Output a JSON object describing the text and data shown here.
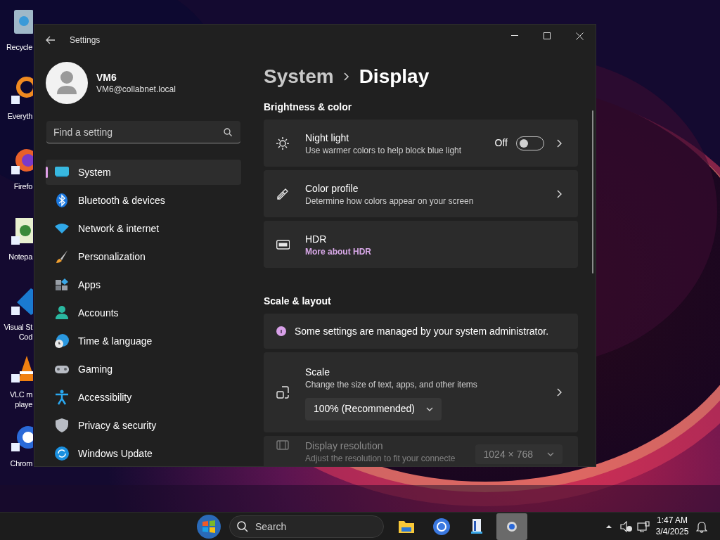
{
  "desktop": {
    "icons": [
      {
        "lines": [
          "Recycle"
        ]
      },
      {
        "lines": [
          "Everyth"
        ]
      },
      {
        "lines": [
          "Firefo"
        ]
      },
      {
        "lines": [
          "Notepa"
        ]
      },
      {
        "lines": [
          "Visual St",
          "Cod"
        ]
      },
      {
        "lines": [
          "VLC m",
          "playe"
        ]
      },
      {
        "lines": [
          "Chrom"
        ]
      }
    ]
  },
  "window": {
    "title": "Settings",
    "user": {
      "name": "VM6",
      "email": "VM6@collabnet.local"
    },
    "search": {
      "placeholder": "Find a setting"
    },
    "nav": [
      {
        "label": "System",
        "selected": true
      },
      {
        "label": "Bluetooth & devices",
        "selected": false
      },
      {
        "label": "Network & internet",
        "selected": false
      },
      {
        "label": "Personalization",
        "selected": false
      },
      {
        "label": "Apps",
        "selected": false
      },
      {
        "label": "Accounts",
        "selected": false
      },
      {
        "label": "Time & language",
        "selected": false
      },
      {
        "label": "Gaming",
        "selected": false
      },
      {
        "label": "Accessibility",
        "selected": false
      },
      {
        "label": "Privacy & security",
        "selected": false
      },
      {
        "label": "Windows Update",
        "selected": false
      }
    ],
    "breadcrumb": {
      "parent": "System",
      "current": "Display"
    },
    "sections": [
      {
        "title": "Brightness & color",
        "cards": [
          {
            "kind": "toggle",
            "title": "Night light",
            "subtitle": "Use warmer colors to help block blue light",
            "state_label": "Off",
            "on": false,
            "chevron": true
          },
          {
            "kind": "nav",
            "title": "Color profile",
            "subtitle": "Determine how colors appear on your screen",
            "chevron": true
          },
          {
            "kind": "link",
            "title": "HDR",
            "link": "More about HDR",
            "chevron": false
          }
        ]
      },
      {
        "title": "Scale & layout",
        "cards": [
          {
            "kind": "notice",
            "text": "Some settings are managed by your system administrator."
          },
          {
            "kind": "dropdown",
            "title": "Scale",
            "subtitle": "Change the size of text, apps, and other items",
            "value": "100% (Recommended)",
            "disabled": false,
            "chevron": true
          },
          {
            "kind": "dropdown",
            "title": "Display resolution",
            "subtitle": "Adjust the resolution to fit your connecte",
            "value": "1024 × 768",
            "disabled": true,
            "chevron": false
          }
        ]
      }
    ]
  },
  "taskbar": {
    "search_placeholder": "Search",
    "apps": [
      {
        "selected": false
      },
      {
        "selected": false
      },
      {
        "selected": false
      },
      {
        "selected": true
      }
    ],
    "time": "1:47 AM",
    "date": "3/4/2025"
  }
}
